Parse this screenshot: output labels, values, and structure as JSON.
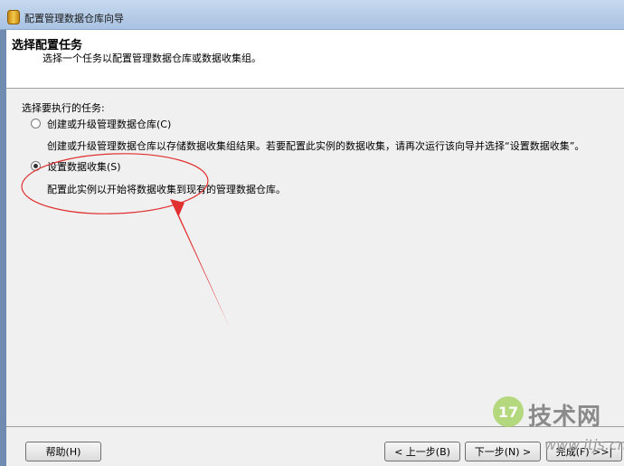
{
  "window": {
    "title": "配置管理数据仓库向导",
    "icon": "database-icon"
  },
  "header": {
    "title": "选择配置任务",
    "subtitle": "选择一个任务以配置管理数据仓库或数据收集组。"
  },
  "body": {
    "task_label": "选择要执行的任务:",
    "options": [
      {
        "label": "创建或升级管理数据仓库(C)",
        "description": "创建或升级管理数据仓库以存储数据收集组结果。若要配置此实例的数据收集，请再次运行该向导并选择“设置数据收集”。",
        "selected": false
      },
      {
        "label": "设置数据收集(S)",
        "description": "配置此实例以开始将数据收集到现有的管理数据仓库。",
        "selected": true
      }
    ]
  },
  "annotation": {
    "color": "#e03030"
  },
  "footer": {
    "help": "帮助(H)",
    "back": "< 上一步(B)",
    "next": "下一步(N) >",
    "finish": "完成(F) >>|"
  },
  "watermark": {
    "badge": "17",
    "name": "技术网",
    "url": "www.itjs.cn"
  }
}
